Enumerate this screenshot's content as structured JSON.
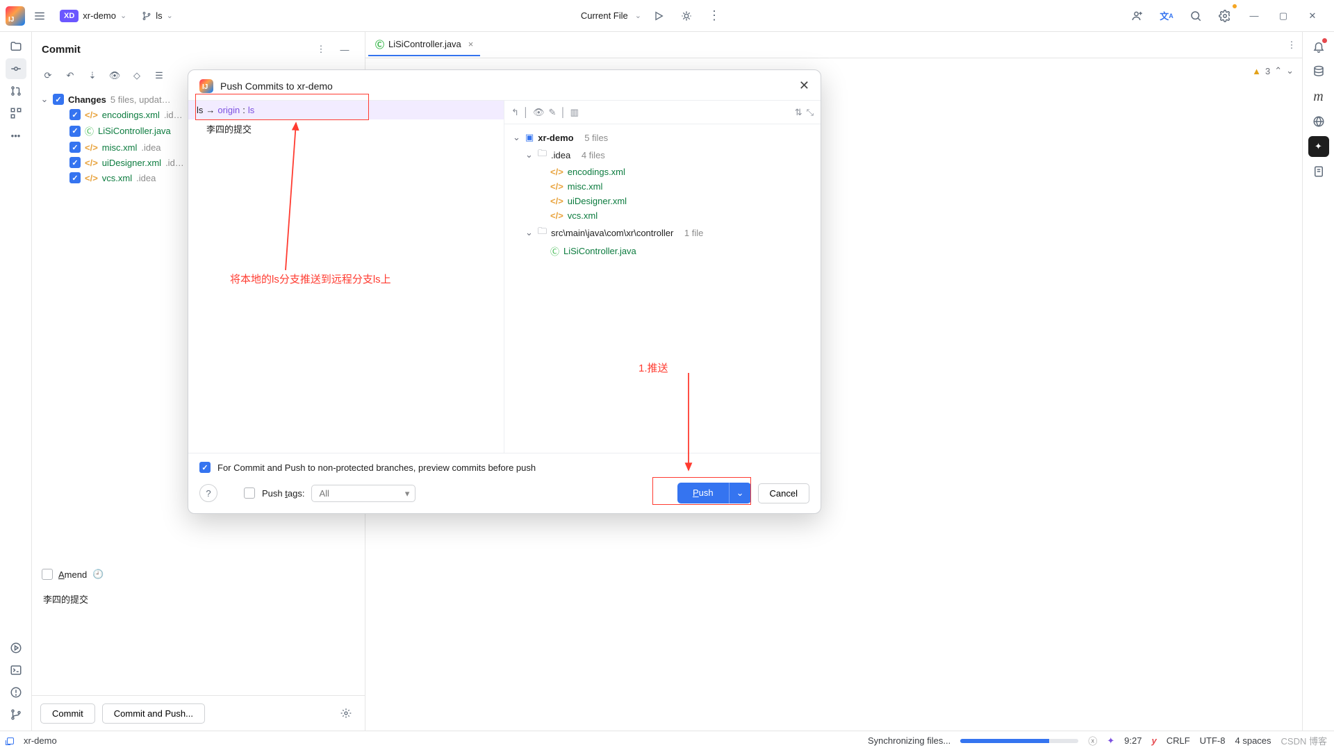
{
  "topbar": {
    "project": "xr-demo",
    "project_badge": "XD",
    "branch": "ls",
    "current_file": "Current File"
  },
  "commit": {
    "title": "Commit",
    "changes_label": "Changes",
    "changes_summary": "5 files, updat…",
    "files": [
      {
        "name": "encodings.xml",
        "path": ".id…",
        "type": "xml"
      },
      {
        "name": "LiSiController.java",
        "path": "",
        "type": "java"
      },
      {
        "name": "misc.xml",
        "path": ".idea",
        "type": "xml"
      },
      {
        "name": "uiDesigner.xml",
        "path": ".id…",
        "type": "xml"
      },
      {
        "name": "vcs.xml",
        "path": ".idea",
        "type": "xml"
      }
    ],
    "amend": "Amend",
    "message": "李四的提交",
    "commit_btn": "Commit",
    "commit_push_btn": "Commit and Push..."
  },
  "editor": {
    "tab": "LiSiController.java",
    "warn_count": "3"
  },
  "dialog": {
    "title": "Push Commits to xr-demo",
    "local_branch": "ls",
    "arrow": "→",
    "remote": "origin",
    "sep": ":",
    "remote_branch": "ls",
    "commit_msg": "李四的提交",
    "root": {
      "name": "xr-demo",
      "meta": "5 files"
    },
    "idea": {
      "name": ".idea",
      "meta": "4 files"
    },
    "idea_files": [
      "encodings.xml",
      "misc.xml",
      "uiDesigner.xml",
      "vcs.xml"
    ],
    "src": {
      "name": "src\\main\\java\\com\\xr\\controller",
      "meta": "1 file"
    },
    "src_file": "LiSiController.java",
    "preview_label": "For Commit and Push to non-protected branches, preview commits before push",
    "push_tags_label": "Push tags:",
    "push_tags_value": "All",
    "push_btn": "Push",
    "cancel_btn": "Cancel"
  },
  "annotations": {
    "explain": "将本地的ls分支推送到远程分支ls上",
    "push": "1.推送"
  },
  "statusbar": {
    "project": "xr-demo",
    "sync": "Synchronizing files...",
    "time": "9:27",
    "crlf": "CRLF",
    "enc": "UTF-8",
    "indent": "4 spaces",
    "watermark": "CSDN 博客"
  }
}
